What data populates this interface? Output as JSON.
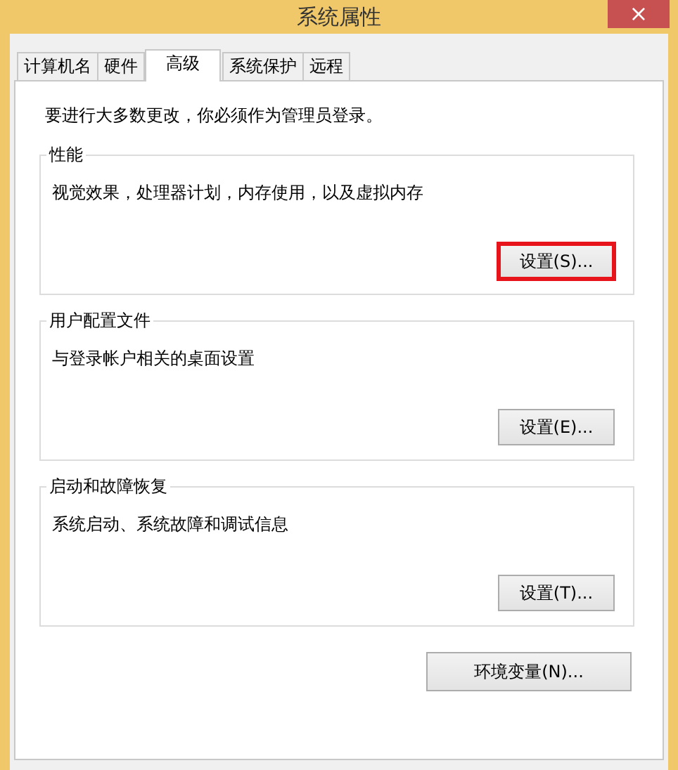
{
  "window": {
    "title": "系统属性",
    "close": "×"
  },
  "tabs": [
    {
      "label": "计算机名",
      "selected": false
    },
    {
      "label": "硬件",
      "selected": false
    },
    {
      "label": "高级",
      "selected": true
    },
    {
      "label": "系统保护",
      "selected": false
    },
    {
      "label": "远程",
      "selected": false
    }
  ],
  "notice": "要进行大多数更改，你必须作为管理员登录。",
  "groups": [
    {
      "title": "性能",
      "description": "视觉效果，处理器计划，内存使用，以及虚拟内存",
      "button": {
        "label": "设置(S)...",
        "highlighted": true
      }
    },
    {
      "title": "用户配置文件",
      "description": "与登录帐户相关的桌面设置",
      "button": {
        "label": "设置(E)...",
        "highlighted": false
      }
    },
    {
      "title": "启动和故障恢复",
      "description": "系统启动、系统故障和调试信息",
      "button": {
        "label": "设置(T)...",
        "highlighted": false
      }
    }
  ],
  "env_button": "环境变量(N)..."
}
